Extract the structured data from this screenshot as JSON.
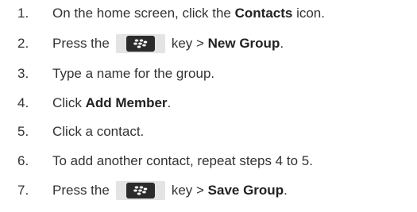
{
  "steps": [
    {
      "number": "1.",
      "parts": {
        "a": "On the home screen, click the ",
        "b": "Contacts",
        "c": " icon."
      }
    },
    {
      "number": "2.",
      "parts": {
        "a": "Press the",
        "icon": "blackberry-menu-key-icon",
        "c": "key > ",
        "b": "New Group",
        "d": "."
      }
    },
    {
      "number": "3.",
      "parts": {
        "a": "Type a name for the group."
      }
    },
    {
      "number": "4.",
      "parts": {
        "a": "Click ",
        "b": "Add Member",
        "c": "."
      }
    },
    {
      "number": "5.",
      "parts": {
        "a": "Click a contact."
      }
    },
    {
      "number": "6.",
      "parts": {
        "a": "To add another contact, repeat steps 4 to 5."
      }
    },
    {
      "number": "7.",
      "parts": {
        "a": "Press the",
        "icon": "blackberry-menu-key-icon",
        "c": "key > ",
        "b": "Save Group",
        "d": "."
      }
    }
  ],
  "colors": {
    "text": "#333333",
    "key_background": "#e4e4e4",
    "key_pill": "#2b2b2b",
    "key_glyph": "#ffffff"
  }
}
